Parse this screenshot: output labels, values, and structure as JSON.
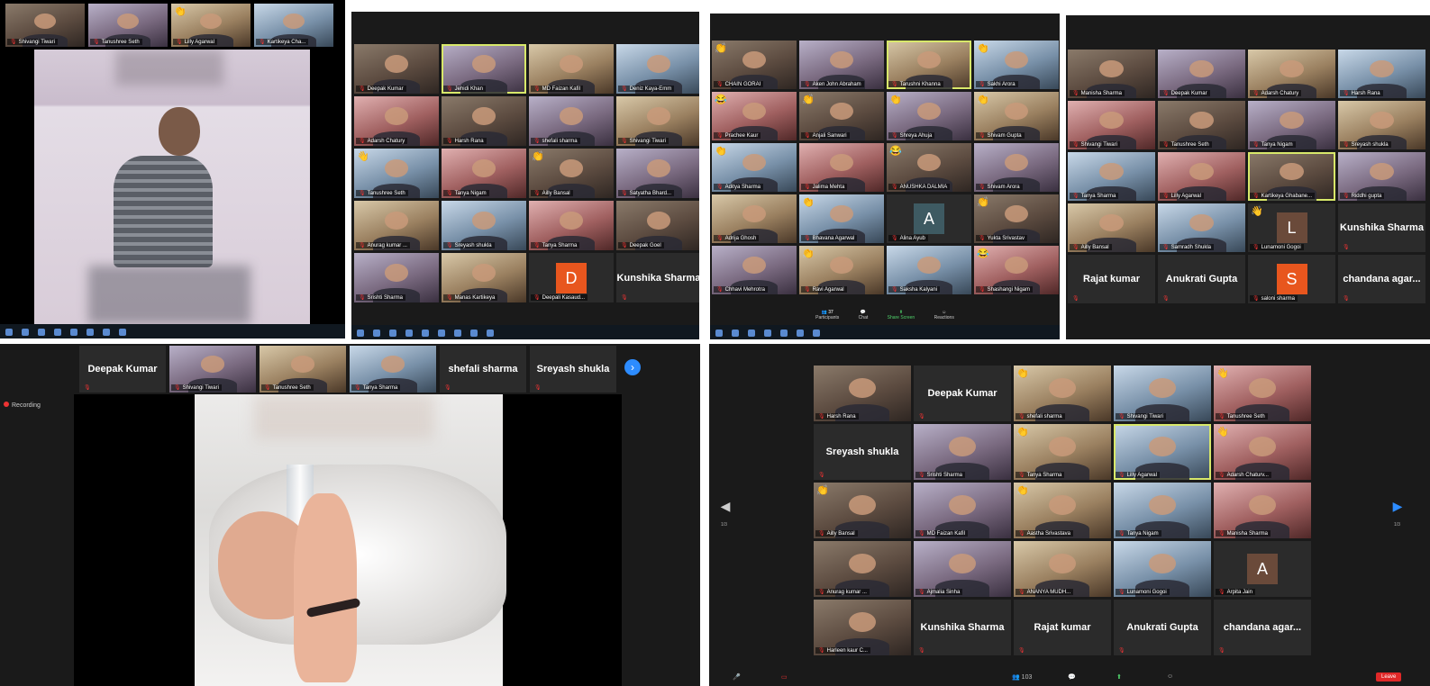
{
  "panel1": {
    "strip": [
      {
        "name": "Shivangi Tiwari"
      },
      {
        "name": "Tanushree Seth"
      },
      {
        "name": "Lilly Agarwal",
        "react": "👏"
      },
      {
        "name": "Kartikeya Cha..."
      }
    ]
  },
  "panel2": {
    "tiles": [
      {
        "name": "Deepak Kumar"
      },
      {
        "name": "Jehidi Khan",
        "hl": true
      },
      {
        "name": "MD Faizan Kafil"
      },
      {
        "name": "Deniz Kaya-Emm"
      },
      {
        "name": "Adarsh Chatury"
      },
      {
        "name": "Harsh Rana"
      },
      {
        "name": "shefali sharma"
      },
      {
        "name": "Shivangi Tiwari"
      },
      {
        "name": "Tanushree Seth",
        "react": "👋"
      },
      {
        "name": "Tanya Nigam"
      },
      {
        "name": "Ailly Bansal",
        "react": "👏"
      },
      {
        "name": "Satyatha Bhard..."
      },
      {
        "name": "Anurag kumar ..."
      },
      {
        "name": "Sreyash shukla"
      },
      {
        "name": "Tanya Sharma"
      },
      {
        "name": "Deepak Goel"
      },
      {
        "name": "Srishti Sharma"
      },
      {
        "name": "Manas Kartikeya"
      },
      {
        "name": "Deepali Kasaud...",
        "avatar": "D",
        "avatar_color": "#e8561e"
      },
      {
        "name": "Kunshika Sharma",
        "big": true
      }
    ]
  },
  "panel3": {
    "tiles": [
      {
        "name": "CHAIN GORAI",
        "react": "👏"
      },
      {
        "name": "Aken John Abraham"
      },
      {
        "name": "Tarushni Khanna",
        "hl": true
      },
      {
        "name": "Sakhi Arora",
        "react": "👏"
      },
      {
        "name": "Prachee Kaur",
        "react": "😂"
      },
      {
        "name": "Anjali Sanwari",
        "react": "👏"
      },
      {
        "name": "Shreya Ahuja",
        "react": "👏"
      },
      {
        "name": "Shivam Gupta",
        "react": "👏"
      },
      {
        "name": "Aditya Sharma",
        "react": "👏"
      },
      {
        "name": "Jalima Mehta"
      },
      {
        "name": "ANUSHKA DALMIA",
        "react": "😂"
      },
      {
        "name": "Shivam Arora"
      },
      {
        "name": "Adrija Ghosh"
      },
      {
        "name": "Bhavana Agarwal",
        "react": "👏"
      },
      {
        "name": "Alina Ayub",
        "avatar": "A",
        "avatar_color": "#3e5a62"
      },
      {
        "name": "Yukta Srivastav",
        "react": "👏"
      },
      {
        "name": "Chhavi Mehrotra"
      },
      {
        "name": "Ravi Agarwal",
        "react": "👏"
      },
      {
        "name": "Saksha Kalyani"
      },
      {
        "name": "Shashangi Nigam",
        "react": "😂"
      }
    ],
    "toolbar": [
      "Participants",
      "Chat",
      "Share Screen",
      "Reactions"
    ],
    "participants_count": "37"
  },
  "panel4": {
    "tiles": [
      {
        "name": "Manisha Sharma"
      },
      {
        "name": "Deepak Kumar"
      },
      {
        "name": "Adarsh Chatury"
      },
      {
        "name": "Harsh Rana"
      },
      {
        "name": "Shivangi Tiwari"
      },
      {
        "name": "Tanushree Seth"
      },
      {
        "name": "Tanya Nigam"
      },
      {
        "name": "Sreyash shukla"
      },
      {
        "name": "Tanya Sharma"
      },
      {
        "name": "Lilly Agarwal"
      },
      {
        "name": "Kartikeya Ghabane...",
        "hl": true
      },
      {
        "name": "Riddhi gupta"
      },
      {
        "name": "Ailly Bansal"
      },
      {
        "name": "Samradh Shukla"
      },
      {
        "name": "Lunamoni Gogoi",
        "avatar": "L",
        "avatar_color": "#6a4a3a",
        "react": "👋"
      },
      {
        "name": "Kunshika Sharma",
        "big": true
      },
      {
        "name": "Rajat kumar",
        "big": true
      },
      {
        "name": "Anukrati Gupta",
        "big": true
      },
      {
        "name": "saloni sharma",
        "avatar": "S",
        "avatar_color": "#e8561e"
      },
      {
        "name": "chandana  agar...",
        "big": true
      }
    ]
  },
  "panel5": {
    "strip": [
      {
        "name": "Deepak Kumar",
        "big": true
      },
      {
        "name": "Shivangi Tiwari"
      },
      {
        "name": "Tanushree Seth"
      },
      {
        "name": "Tanya Sharma"
      },
      {
        "name": "shefali sharma",
        "big": true
      },
      {
        "name": "Sreyash shukla",
        "big": true
      }
    ],
    "recording": "Recording"
  },
  "panel6": {
    "tiles": [
      {
        "name": "Harsh Rana"
      },
      {
        "name": "Deepak Kumar",
        "big": true
      },
      {
        "name": "shefali sharma",
        "react": "👏"
      },
      {
        "name": "Shivangi Tiwari"
      },
      {
        "name": "Tanushree Seth",
        "react": "👋"
      },
      {
        "name": "Sreyash shukla",
        "big": true
      },
      {
        "name": "Srishti Sharma"
      },
      {
        "name": "Tanya Sharma",
        "react": "👏"
      },
      {
        "name": "Lilly Agarwal",
        "hl": true
      },
      {
        "name": "Adarsh Chaturv...",
        "react": "👋"
      },
      {
        "name": "Ailly Bansal",
        "react": "👏"
      },
      {
        "name": "MD Faizan Kafil"
      },
      {
        "name": "Aastha Srivastava",
        "react": "👏"
      },
      {
        "name": "Tanya Nigam"
      },
      {
        "name": "Manisha Sharma"
      },
      {
        "name": "Anurag kumar ..."
      },
      {
        "name": "Ajmalia Sinha"
      },
      {
        "name": "ANANYA MUDH..."
      },
      {
        "name": "Lunamoni Gogoi"
      },
      {
        "name": "Arpita Jain",
        "avatar": "A",
        "avatar_color": "#6a4a3a"
      },
      {
        "name": "Harleen kaur C..."
      },
      {
        "name": "Kunshika Sharma",
        "big": true
      },
      {
        "name": "Rajat kumar",
        "big": true
      },
      {
        "name": "Anukrati Gupta",
        "big": true
      },
      {
        "name": "chandana  agar...",
        "big": true
      }
    ],
    "page_left": "1/3",
    "page_right": "1/3",
    "participants_count": "103",
    "leave": "Leave"
  }
}
